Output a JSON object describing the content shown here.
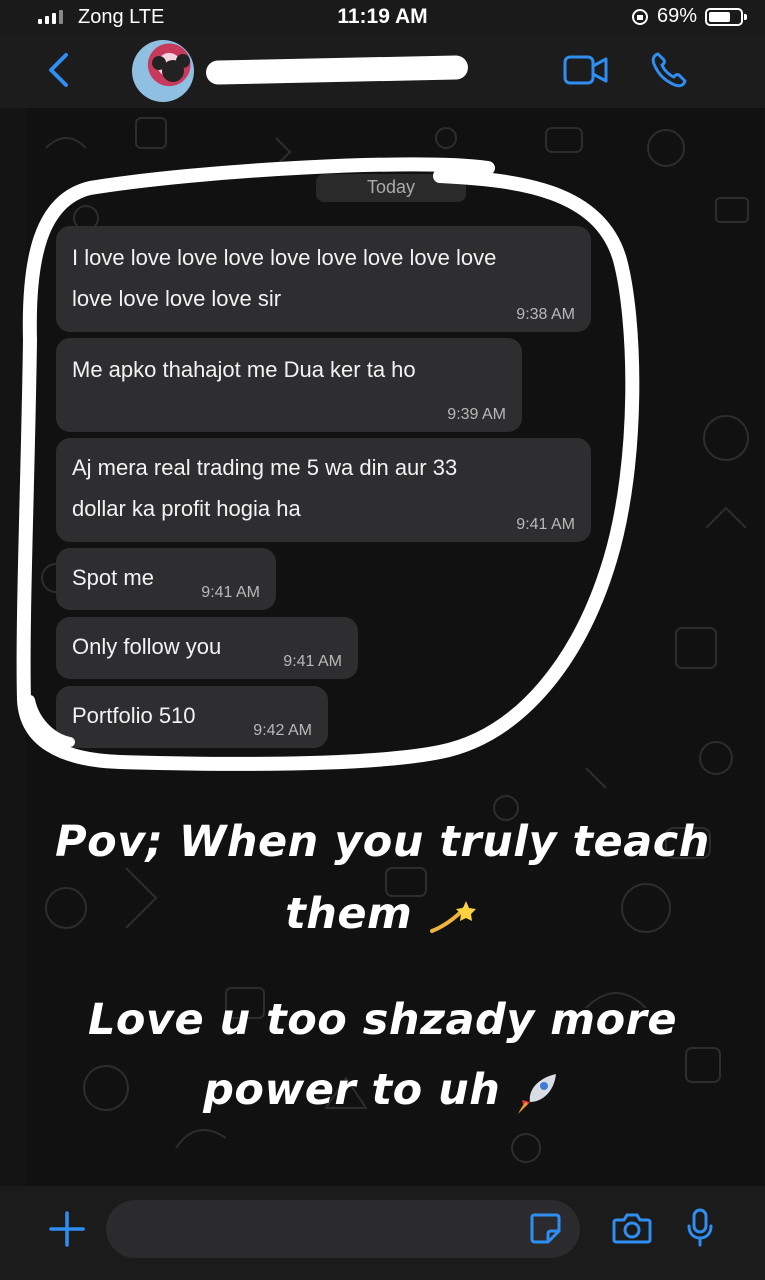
{
  "status_bar": {
    "carrier": "Zong  LTE",
    "time": "11:19 AM",
    "battery": "69%",
    "battery_level": 0.69
  },
  "header": {
    "icons": [
      "back-chevron-icon",
      "video-camera-icon",
      "phone-icon"
    ]
  },
  "chat": {
    "date_label": "Today",
    "messages": [
      {
        "text": "I love love love love love love love love love",
        "text2": "love love love love sir",
        "time": "9:38 AM"
      },
      {
        "text": "Me apko thahajot me Dua ker ta ho",
        "time": "9:39 AM"
      },
      {
        "text": "Aj mera real trading me 5 wa din aur 33",
        "text2": "dollar ka profit hogia ha",
        "time": "9:41 AM"
      },
      {
        "text": "Spot me",
        "time": "9:41 AM"
      },
      {
        "text": "Only follow you",
        "time": "9:41 AM"
      },
      {
        "text": "Portfolio 510",
        "time": "9:42 AM"
      }
    ]
  },
  "overlay": {
    "line1": "Pov; When you truly teach",
    "line2": "them",
    "line3": "Love u too shzady more",
    "line4": "power to uh"
  },
  "input_bar": {
    "icons": [
      "plus-icon",
      "sticker-icon",
      "camera-icon",
      "microphone-icon"
    ]
  },
  "colors": {
    "accent": "#2f8ef2",
    "bubble": "#2e2e30",
    "background": "#111111"
  }
}
